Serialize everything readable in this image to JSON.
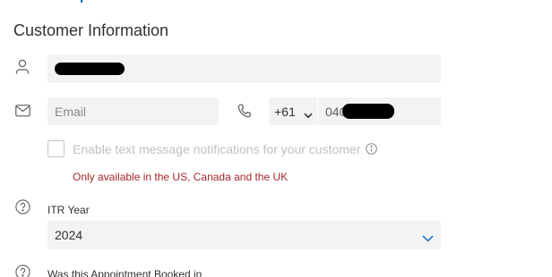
{
  "section": {
    "title": "Customer Information"
  },
  "contact": {
    "email_placeholder": "Email",
    "country_code": "+61",
    "phone_prefix": "040"
  },
  "sms": {
    "label": "Enable text message notifications for your customer",
    "checked": false,
    "availability_note": "Only available in the US, Canada and the UK"
  },
  "itr": {
    "label": "ITR Year",
    "value": "2024"
  },
  "next_field": {
    "label": "Was this Appointment Booked in"
  },
  "colors": {
    "accent": "#0f6cbd",
    "field_bg": "#f3f3f3",
    "error": "#a4262c"
  }
}
